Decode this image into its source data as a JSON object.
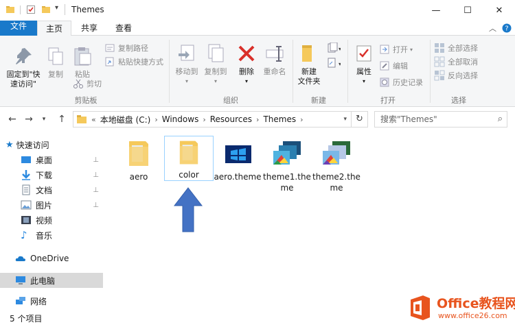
{
  "window": {
    "title": "Themes",
    "minimize_glyph": "—",
    "maximize_glyph": "☐",
    "close_glyph": "✕"
  },
  "tabs": {
    "file": "文件",
    "home": "主页",
    "share": "共享",
    "view": "查看"
  },
  "ribbon": {
    "clipboard": {
      "label": "剪贴板",
      "pin_quick_access_line1": "固定到\"快",
      "pin_quick_access_line2": "速访问\"",
      "copy": "复制",
      "paste": "粘贴",
      "copy_path": "复制路径",
      "paste_shortcut": "粘贴快捷方式",
      "cut": "剪切"
    },
    "organize": {
      "label": "组织",
      "move_to": "移动到",
      "copy_to": "复制到",
      "delete": "删除",
      "rename": "重命名"
    },
    "new": {
      "label": "新建",
      "new_folder_line1": "新建",
      "new_folder_line2": "文件夹"
    },
    "open": {
      "label": "打开",
      "properties": "属性",
      "open": "打开",
      "edit": "编辑",
      "history": "历史记录"
    },
    "select": {
      "label": "选择",
      "select_all": "全部选择",
      "select_none": "全部取消",
      "invert": "反向选择"
    }
  },
  "address": {
    "prefix": "«",
    "crumbs": [
      "本地磁盘 (C:)",
      "Windows",
      "Resources",
      "Themes"
    ],
    "search_placeholder": "搜索\"Themes\""
  },
  "nav": {
    "quick_access": "快速访问",
    "desktop": "桌面",
    "downloads": "下载",
    "documents": "文档",
    "pictures": "图片",
    "videos": "视频",
    "music": "音乐",
    "onedrive": "OneDrive",
    "this_pc": "此电脑",
    "network": "网络"
  },
  "files": [
    {
      "name": "aero",
      "type": "folder"
    },
    {
      "name": "color",
      "type": "folder"
    },
    {
      "name": "aero.theme",
      "type": "theme"
    },
    {
      "name": "theme1.theme",
      "type": "theme"
    },
    {
      "name": "theme2.theme",
      "type": "theme"
    }
  ],
  "status": {
    "item_count": "5 个项目"
  },
  "watermark": {
    "brand": "Office教程网",
    "url": "www.office26.com"
  },
  "colors": {
    "accent": "#1979ca",
    "arrow": "#4472c4",
    "folder": "#f5c95b",
    "office_orange": "#e8541e"
  }
}
